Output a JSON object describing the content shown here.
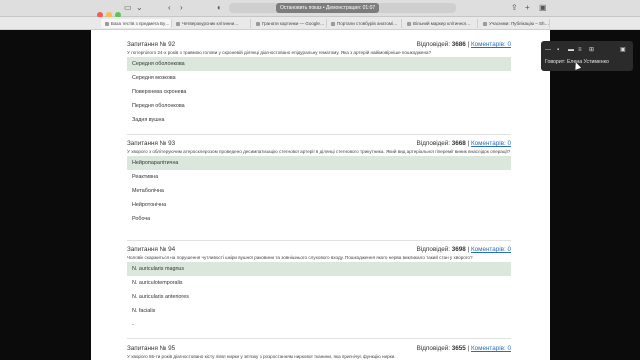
{
  "browser": {
    "share_banner": "Остановить показ • Демонстрация: 01:07",
    "tabs": [
      "База тестів з предмета Бу…",
      "Четверокурсник клітинни…",
      "Гранати картинки — Google…",
      "Портали стовбурів анатомі…",
      "Вільний маркер клітинної…",
      "Учасники: Публікацію – Sh…"
    ]
  },
  "zoom": {
    "speaker_label": "Говорит: Елена Устименко"
  },
  "questions": [
    {
      "title": "Запитання №",
      "number": "92",
      "answers_label": "Відповідей:",
      "answers_count": "3686",
      "comments_label": "Коментарів: 0",
      "text": "У потерпілого 24-х років з травмою голови у скроневій ділянці діагностовано епідуральну гематому. Яка з артерій найімовірніше пошкоджена?",
      "options": [
        "Середня оболонкова",
        "Середня мозкова",
        "Поверхнева скронева",
        "Передня оболонкова",
        "Задня вушна"
      ]
    },
    {
      "title": "Запитання №",
      "number": "93",
      "answers_label": "Відповідей:",
      "answers_count": "3668",
      "comments_label": "Коментарів: 0",
      "text": "У хворого з облітеруючим атеросклерозом проведено десимпатизацію стегнової артерії в ділянці стегнового трикутника. Який вид артеріальної гіперемії виник внаслідок операції?",
      "options": [
        "Нейропаралітична",
        "Реактивна",
        "Метаболічна",
        "Нейротонічна",
        "Робоча"
      ]
    },
    {
      "title": "Запитання №",
      "number": "94",
      "answers_label": "Відповідей:",
      "answers_count": "3698",
      "comments_label": "Коментарів: 0",
      "text": "Чоловік скаржиться на порушення чутливості шкіри вушної раковини та зовнішнього слухового входу. Пошкодження якого нерва викликало такий стан у хворого?",
      "options": [
        "N. auricularis magnus",
        "N. auriculotemporalis",
        "N. auricularis anteriores",
        "N. facialis",
        "-"
      ]
    },
    {
      "title": "Запитання №",
      "number": "95",
      "answers_label": "Відповідей:",
      "answers_count": "3655",
      "comments_label": "Коментарів: 0",
      "text": "У хворого 55-ти років діагностовано кісту лівої нирки у зв'язку з розростанням ниркової тканини, яка пригнічує функцію нирки."
    }
  ]
}
